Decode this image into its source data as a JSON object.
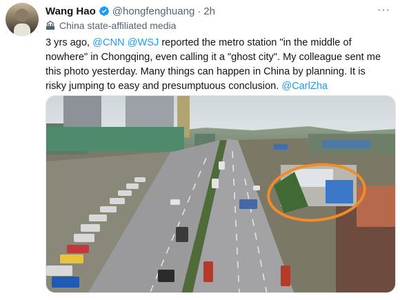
{
  "tweet": {
    "author_name": "Wang Hao",
    "author_handle": "@hongfenghuang",
    "separator": "·",
    "timestamp": "2h",
    "label": "China state-affiliated media",
    "more_glyph": "···",
    "lines": [
      {
        "parts": [
          {
            "t": "3 yrs ago, "
          },
          {
            "t": "@CNN",
            "m": true
          },
          {
            "t": " "
          },
          {
            "t": "@WSJ",
            "m": true
          },
          {
            "t": " reported the metro station \"in the middle of"
          }
        ]
      },
      {
        "parts": [
          {
            "t": "nowhere\" in Chongqing, even calling it a \"ghost city\".  My colleague sent me"
          }
        ]
      },
      {
        "parts": [
          {
            "t": "this photo yesterday. Many things can happen in China by planning. It is"
          }
        ]
      },
      {
        "parts": [
          {
            "t": "risky jumping to easy and presumptuous conclusion. "
          },
          {
            "t": "@CarlZha",
            "m": true
          }
        ]
      }
    ]
  },
  "icons": {
    "verified": "verified-badge-icon",
    "label": "state-media-flag-icon",
    "more": "more-options-icon"
  },
  "colors": {
    "link": "#1d9bf0",
    "text": "#0f1419",
    "muted": "#536471",
    "annotation": "#f28c28"
  },
  "media": {
    "alt": "aerial photo of a busy road beside a metro construction site with an orange circle"
  }
}
